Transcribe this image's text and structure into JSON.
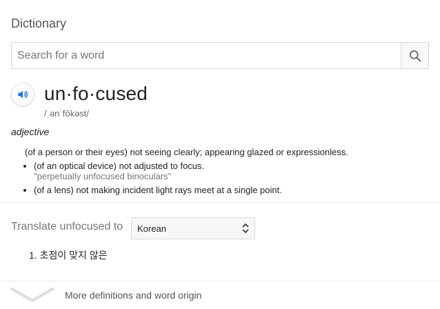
{
  "card": {
    "title": "Dictionary"
  },
  "search": {
    "placeholder": "Search for a word"
  },
  "entry": {
    "headword": "un·fo·cused",
    "phonetic": "/ˌənˈfōkəst/",
    "part_of_speech": "adjective",
    "main_definition": "(of a person or their eyes) not seeing clearly; appearing glazed or expressionless.",
    "sub_definitions": [
      {
        "text": "(of an optical device) not adjusted to focus.",
        "example": "\"perpetually unfocused binoculars\""
      },
      {
        "text": "(of a lens) not making incident light rays meet at a single point."
      }
    ]
  },
  "translate": {
    "label": "Translate unfocused to",
    "selected_language": "Korean",
    "results": [
      "1. 초점이 맞지 않은"
    ]
  },
  "footer": {
    "more_label": "More definitions and word origin"
  },
  "colors": {
    "speaker_icon": "#1a73e8",
    "search_icon": "#757575",
    "divider": "#ececec",
    "chevron": "#dcdcdc"
  }
}
